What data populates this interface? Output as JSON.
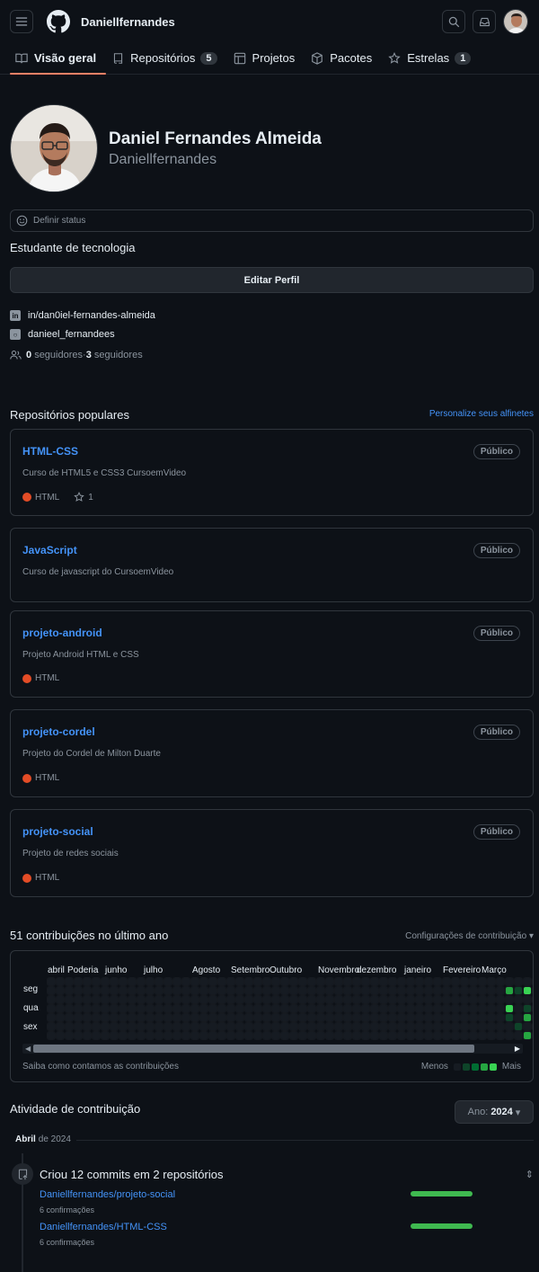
{
  "header": {
    "username": "Daniellfernandes"
  },
  "tabs": [
    {
      "label": "Visão geral"
    },
    {
      "label": "Repositórios",
      "count": "5"
    },
    {
      "label": "Projetos"
    },
    {
      "label": "Pacotes"
    },
    {
      "label": "Estrelas",
      "count": "1"
    }
  ],
  "profile": {
    "full_name": "Daniel Fernandes Almeida",
    "login": "Daniellfernandes",
    "status": "Definir status",
    "bio": "Estudante de tecnologia",
    "edit_label": "Editar Perfil",
    "linkedin": "in/dan0iel-fernandes-almeida",
    "instagram": "danieel_fernandees",
    "followers_count": "0",
    "followers_label": "seguidores",
    "following_sep": " · ",
    "following_count": "3",
    "following_label": "seguidores"
  },
  "popular": {
    "title": "Repositórios populares",
    "customize": "Personalize seus alfinetes",
    "repos": [
      {
        "name": "HTML-CSS",
        "badge": "Público",
        "desc": "Curso de HTML5 e CSS3 CursoemVideo",
        "lang": "HTML",
        "stars": "1"
      },
      {
        "name": "JavaScript",
        "badge": "Público",
        "desc": "Curso de javascript do CursoemVideo"
      },
      {
        "name": "projeto-android",
        "badge": "Público",
        "desc": "Projeto Android HTML e CSS",
        "lang": "HTML"
      },
      {
        "name": "projeto-cordel",
        "badge": "Público",
        "desc": "Projeto do Cordel de Milton Duarte",
        "lang": "HTML"
      },
      {
        "name": "projeto-social",
        "badge": "Público",
        "desc": "Projeto de redes sociais",
        "lang": "HTML"
      }
    ]
  },
  "contributions": {
    "title": "51 contribuições no último ano",
    "settings": "Configurações de contribuição",
    "months": [
      "abril",
      "Poderia",
      "junho",
      "julho",
      "Agosto",
      "Setembro",
      "Outubro",
      "Novembro",
      "dezembro",
      "janeiro",
      "Fevereiro",
      "Março"
    ],
    "days": [
      "seg",
      "qua",
      "sex"
    ],
    "how": "Saiba como contamos as contribuições",
    "less": "Menos",
    "more": "Mais",
    "colors": {
      "empty": "#161b22",
      "l1": "#0e4429",
      "l2": "#006d32",
      "l3": "#26a641",
      "l4": "#39d353"
    }
  },
  "activity": {
    "title": "Atividade de contribuição",
    "year_prefix": "Ano:",
    "year": "2024",
    "month": "Abril",
    "month_year": "de 2024",
    "commits_title": "Criou 12 commits em 2 repositórios",
    "items": [
      {
        "repo": "Daniellfernandes/projeto-social",
        "count": "6 confirmações",
        "share": 1.0
      },
      {
        "repo": "Daniellfernandes/HTML-CSS",
        "count": "6 confirmações",
        "share": 1.0
      }
    ]
  }
}
